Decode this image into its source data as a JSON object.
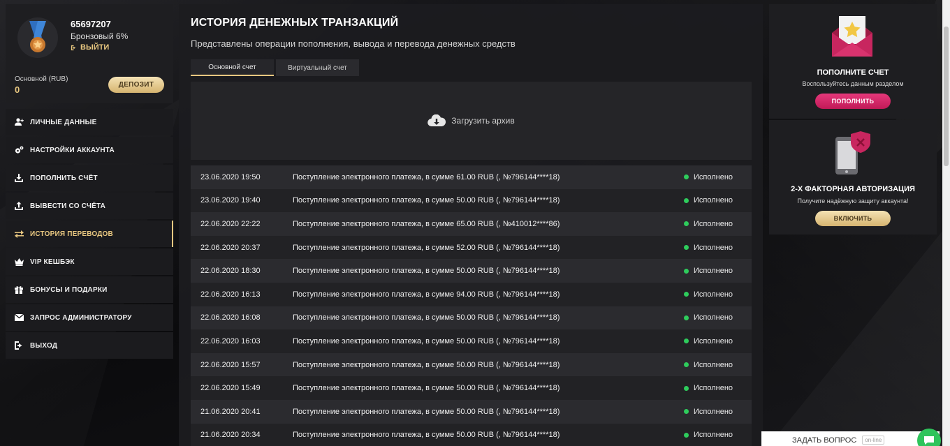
{
  "profile": {
    "user_id": "65697207",
    "level": "Бронзовый 6%",
    "logout_label": "ВЫЙТИ",
    "balance_label": "Основной (RUB)",
    "balance_value": "0",
    "deposit_label": "ДЕПОЗИТ"
  },
  "menu": [
    {
      "label": "ЛИЧНЫЕ ДАННЫЕ",
      "icon": "user-plus-icon"
    },
    {
      "label": "НАСТРОЙКИ АККАУНТА",
      "icon": "gears-icon"
    },
    {
      "label": "ПОПОЛНИТЬ СЧЁТ",
      "icon": "download-icon"
    },
    {
      "label": "ВЫВЕСТИ СО СЧЁТА",
      "icon": "upload-icon"
    },
    {
      "label": "ИСТОРИЯ ПЕРЕВОДОВ",
      "icon": "exchange-icon",
      "active": true
    },
    {
      "label": "VIP КЕШБЭК",
      "icon": "crown-icon"
    },
    {
      "label": "БОНУСЫ И ПОДАРКИ",
      "icon": "gift-icon"
    },
    {
      "label": "ЗАПРОС АДМИНИСТРАТОРУ",
      "icon": "envelope-icon"
    },
    {
      "label": "ВЫХОД",
      "icon": "sign-out-icon"
    }
  ],
  "main": {
    "title": "ИСТОРИЯ ДЕНЕЖНЫХ ТРАНЗАКЦИЙ",
    "subtitle": "Представлены операции пополнения, вывода и перевода денежных средств",
    "tabs": [
      {
        "label": "Основной счет",
        "active": true
      },
      {
        "label": "Виртуальный счет",
        "active": false
      }
    ],
    "archive_label": "Загрузить архив",
    "transactions": [
      {
        "date": "23.06.2020 19:50",
        "desc": "Поступление электронного платежа, в сумме 61.00 RUB (, №796144****18)",
        "status": "Исполнено"
      },
      {
        "date": "23.06.2020 19:40",
        "desc": "Поступление электронного платежа, в сумме 50.00 RUB (, №796144****18)",
        "status": "Исполнено"
      },
      {
        "date": "22.06.2020 22:22",
        "desc": "Поступление электронного платежа, в сумме 65.00 RUB (, №410012****86)",
        "status": "Исполнено"
      },
      {
        "date": "22.06.2020 20:37",
        "desc": "Поступление электронного платежа, в сумме 52.00 RUB (, №796144****18)",
        "status": "Исполнено"
      },
      {
        "date": "22.06.2020 18:30",
        "desc": "Поступление электронного платежа, в сумме 50.00 RUB (, №796144****18)",
        "status": "Исполнено"
      },
      {
        "date": "22.06.2020 16:13",
        "desc": "Поступление электронного платежа, в сумме 94.00 RUB (, №796144****18)",
        "status": "Исполнено"
      },
      {
        "date": "22.06.2020 16:08",
        "desc": "Поступление электронного платежа, в сумме 50.00 RUB (, №796144****18)",
        "status": "Исполнено"
      },
      {
        "date": "22.06.2020 16:03",
        "desc": "Поступление электронного платежа, в сумме 50.00 RUB (, №796144****18)",
        "status": "Исполнено"
      },
      {
        "date": "22.06.2020 15:57",
        "desc": "Поступление электронного платежа, в сумме 50.00 RUB (, №796144****18)",
        "status": "Исполнено"
      },
      {
        "date": "22.06.2020 15:49",
        "desc": "Поступление электронного платежа, в сумме 50.00 RUB (, №796144****18)",
        "status": "Исполнено"
      },
      {
        "date": "21.06.2020 20:41",
        "desc": "Поступление электронного платежа, в сумме 50.00 RUB (, №796144****18)",
        "status": "Исполнено"
      },
      {
        "date": "21.06.2020 20:34",
        "desc": "Поступление электронного платежа, в сумме 50.00 RUB (, №796144****18)",
        "status": "Исполнено"
      }
    ]
  },
  "promos": [
    {
      "title": "ПОПОЛНИТЕ СЧЕТ",
      "text": "Воспользуйтесь данным разделом",
      "button": "ПОПОЛНИТЬ"
    },
    {
      "title": "2-Х ФАКТОРНАЯ АВТОРИЗАЦИЯ",
      "text": "Получите надёжную защиту аккаунта!",
      "button": "ВКЛЮЧИТЬ"
    }
  ],
  "chat": {
    "label": "ЗАДАТЬ ВОПРОС",
    "badge": "on-line"
  },
  "colors": {
    "accent_gold": "#e8c780",
    "accent_pink": "#d32467",
    "status_green": "#2ecc5c"
  }
}
